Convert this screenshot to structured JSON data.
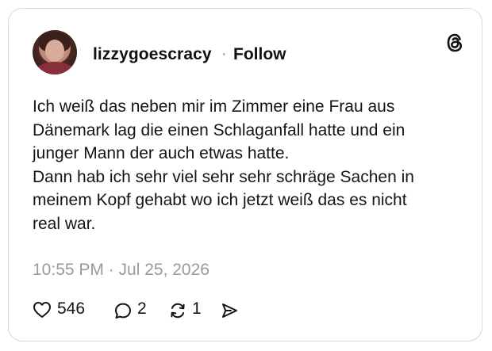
{
  "post": {
    "username": "lizzygoescracy",
    "separator": "·",
    "follow_label": "Follow",
    "text": "Ich weiß das neben mir im Zimmer eine Frau aus\nDänemark lag die einen Schlaganfall hatte und ein\njunger Mann der auch etwas hatte.\nDann hab ich sehr viel sehr sehr schräge Sachen in\nmeinem Kopf gehabt wo ich jetzt weiß das es nicht\nreal war.",
    "timestamp": "10:55 PM · Jul 25, 2026"
  },
  "actions": {
    "likes": "546",
    "replies": "2",
    "reposts": "1"
  },
  "icons": {
    "logo": "threads-logo-icon",
    "like": "heart-icon",
    "reply": "comment-icon",
    "repost": "repost-icon",
    "share": "send-icon"
  },
  "colors": {
    "text": "#141414",
    "muted": "#9a9a9a",
    "border": "#d9d9d9"
  }
}
